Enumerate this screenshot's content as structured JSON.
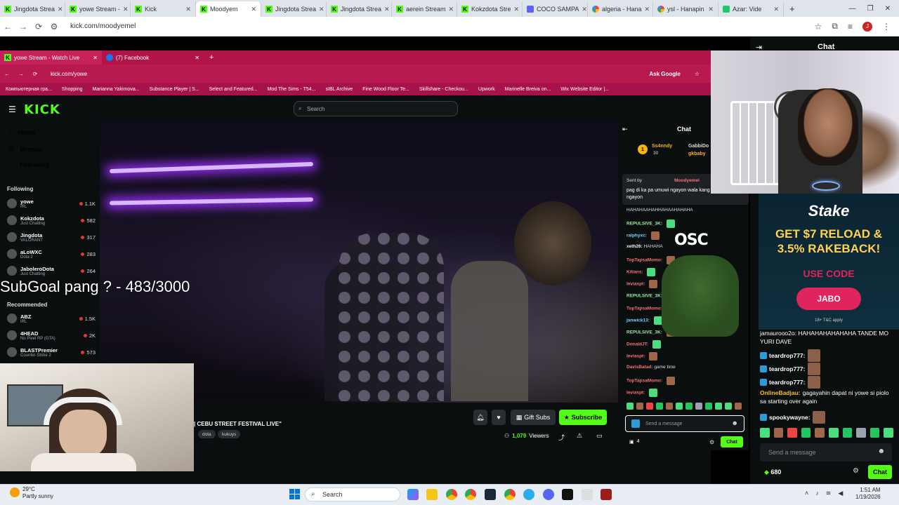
{
  "outer_browser": {
    "tabs": [
      {
        "label": "Jingdota Strea",
        "icon": "kick-icon"
      },
      {
        "label": "yowe Stream -",
        "icon": "kick-icon"
      },
      {
        "label": "Kick",
        "icon": "kick-icon"
      },
      {
        "label": "Moodyem",
        "icon": "kick-icon",
        "active": true
      },
      {
        "label": "Jingdota Strea",
        "icon": "kick-icon"
      },
      {
        "label": "Jingdota Strea",
        "icon": "kick-icon"
      },
      {
        "label": "aerein Stream",
        "icon": "kick-icon"
      },
      {
        "label": "Kokzdota Stre",
        "icon": "kick-icon"
      },
      {
        "label": "COCO SAMPA",
        "icon": "discord-icon"
      },
      {
        "label": "algeria - Hana",
        "icon": "google-icon"
      },
      {
        "label": "ysl - Hanapin",
        "icon": "google-icon"
      },
      {
        "label": "Azar: Vide",
        "icon": "azar-icon"
      }
    ],
    "url": "kick.com/moodyemel"
  },
  "inner_browser": {
    "tabs": [
      "yowe Stream - Watch Live",
      "(7) Facebook"
    ],
    "url": "kick.com/yowe",
    "ask_google": "Ask Google",
    "bookmarks": [
      "Компьютерная гра...",
      "Shopping",
      "Marianna Yakimova...",
      "Substance Player | S...",
      "Select and Featured...",
      "Mod The Sims - T54...",
      "sIBL Archive",
      "Fine Wood Floor Te...",
      "Skillshare - Checkou...",
      "Upwork",
      "Marinelle Breiva on...",
      "Wix Website Editor |..."
    ]
  },
  "kick": {
    "logo": "KICK",
    "search_placeholder": "Search",
    "nav": [
      {
        "label": "Home",
        "icon": "home-icon"
      },
      {
        "label": "Browse",
        "icon": "browse-icon"
      },
      {
        "label": "Following",
        "icon": "heart-icon"
      }
    ],
    "following_title": "Following",
    "following": [
      {
        "name": "yowe",
        "game": "IRL",
        "viewers": "1.1K"
      },
      {
        "name": "Kokzdota",
        "game": "Just Chatting",
        "viewers": "582"
      },
      {
        "name": "Jingdota",
        "game": "VALORANT",
        "viewers": "317"
      },
      {
        "name": "aLoWXC",
        "game": "Dota 2",
        "viewers": "283"
      },
      {
        "name": "JaboleroDota",
        "game": "Just Chatting",
        "viewers": "264"
      }
    ],
    "recommended_title": "Recommended",
    "recommended": [
      {
        "name": "ABZ",
        "game": "IRL",
        "viewers": "1.5K"
      },
      {
        "name": "4HEAD",
        "game": "No Pixel RP (GTA)",
        "viewers": "2K"
      },
      {
        "name": "BLASTPremier",
        "game": "Counter-Strike 2",
        "viewers": "573"
      }
    ],
    "overlay_subgoal": "SubGoal pang ? - 483/3000",
    "stream_title": "| CEBU STREET FESTIVAL LIVE\"",
    "tags": [
      "dota",
      "kukuys"
    ],
    "gift_subs_label": "Gift Subs",
    "subscribe_label": "Subscribe",
    "viewers_count": "1,079",
    "viewers_label": "Viewers",
    "chat_title": "Chat",
    "pinned_users": [
      {
        "name": "Ss4nndy",
        "count": "30"
      },
      {
        "name": "GabbiDo"
      },
      {
        "name": "gkbaby"
      }
    ],
    "pinned_sent_by": "Sent by",
    "pinned_sender": "Moodyemel",
    "pinned_text": "pag di ka pa umuwi ngayon wala kang jowa ngayon",
    "chat_messages": [
      {
        "user": "",
        "text": "HAHAHAAHAHHAHAAHAHAHA",
        "color": "#dddddd"
      },
      {
        "user": "REPULSIVE_3K:",
        "text": "",
        "color": "#9be7a0"
      },
      {
        "user": "ralphyxc:",
        "text": "",
        "color": "#7dd3fc"
      },
      {
        "user": "xeth26:",
        "text": "HAHAHA",
        "color": "#f5f5f5"
      },
      {
        "user": "TopTapsaMomo:",
        "text": "",
        "color": "#f87171"
      },
      {
        "user": "Kilians:",
        "text": "",
        "color": "#f87171"
      },
      {
        "user": "leviaspt:",
        "text": "",
        "color": "#f87171"
      },
      {
        "user": "REPULSIVE_3K:",
        "text": "",
        "color": "#9be7a0"
      },
      {
        "user": "TopTapsaMomo:",
        "text": "",
        "color": "#f87171"
      },
      {
        "user": "janwick13:",
        "text": "",
        "color": "#7dd3fc"
      },
      {
        "user": "REPULSIVE_3K:",
        "text": "",
        "color": "#9be7a0"
      },
      {
        "user": "DonaldJT:",
        "text": "",
        "color": "#f87171"
      },
      {
        "user": "leviaspt:",
        "text": "",
        "color": "#f87171"
      },
      {
        "user": "DavisBatad:",
        "text": "game time",
        "color": "#f87171"
      },
      {
        "user": "TopTapsaMomo:",
        "text": "",
        "color": "#f87171"
      },
      {
        "user": "leviaspt:",
        "text": "",
        "color": "#f87171"
      }
    ],
    "chat_input_placeholder": "Send a message",
    "chat_points": "4",
    "chat_send_label": "Chat"
  },
  "stream_overlay": {
    "chat_title": "Chat",
    "ad": {
      "brand": "Stake",
      "headline1": "GET $7 RELOAD &",
      "headline2": "3.5% RAKEBACK!",
      "use_code": "USE CODE",
      "code": "JABO",
      "disclaimer": "18+ T&C apply",
      "accent": "#e0245e"
    },
    "chat_partial_top": "jamaurooo2o: HAHAHAHAHAHAHA TANDE MO",
    "chat_partial_top2": "YURI DAVE",
    "messages": [
      {
        "user": "teardrop777:",
        "text": ""
      },
      {
        "user": "teardrop777:",
        "text": ""
      },
      {
        "user": "teardrop777:",
        "text": ""
      },
      {
        "user": "OnlineBadjau:",
        "text": "gagayahin dapat ni yowe si piolo",
        "text2": "sa starting over again",
        "color": "#fbbf24"
      },
      {
        "user": "spookywayne:",
        "text": ""
      }
    ],
    "input_placeholder": "Send a message",
    "points": "680",
    "send_label": "Chat",
    "osc_logo": "OSC"
  },
  "taskbar": {
    "weather_temp": "29°C",
    "weather_desc": "Partly sunny",
    "search_label": "Search",
    "time": "1:51 AM",
    "date": "1/19/2026"
  }
}
